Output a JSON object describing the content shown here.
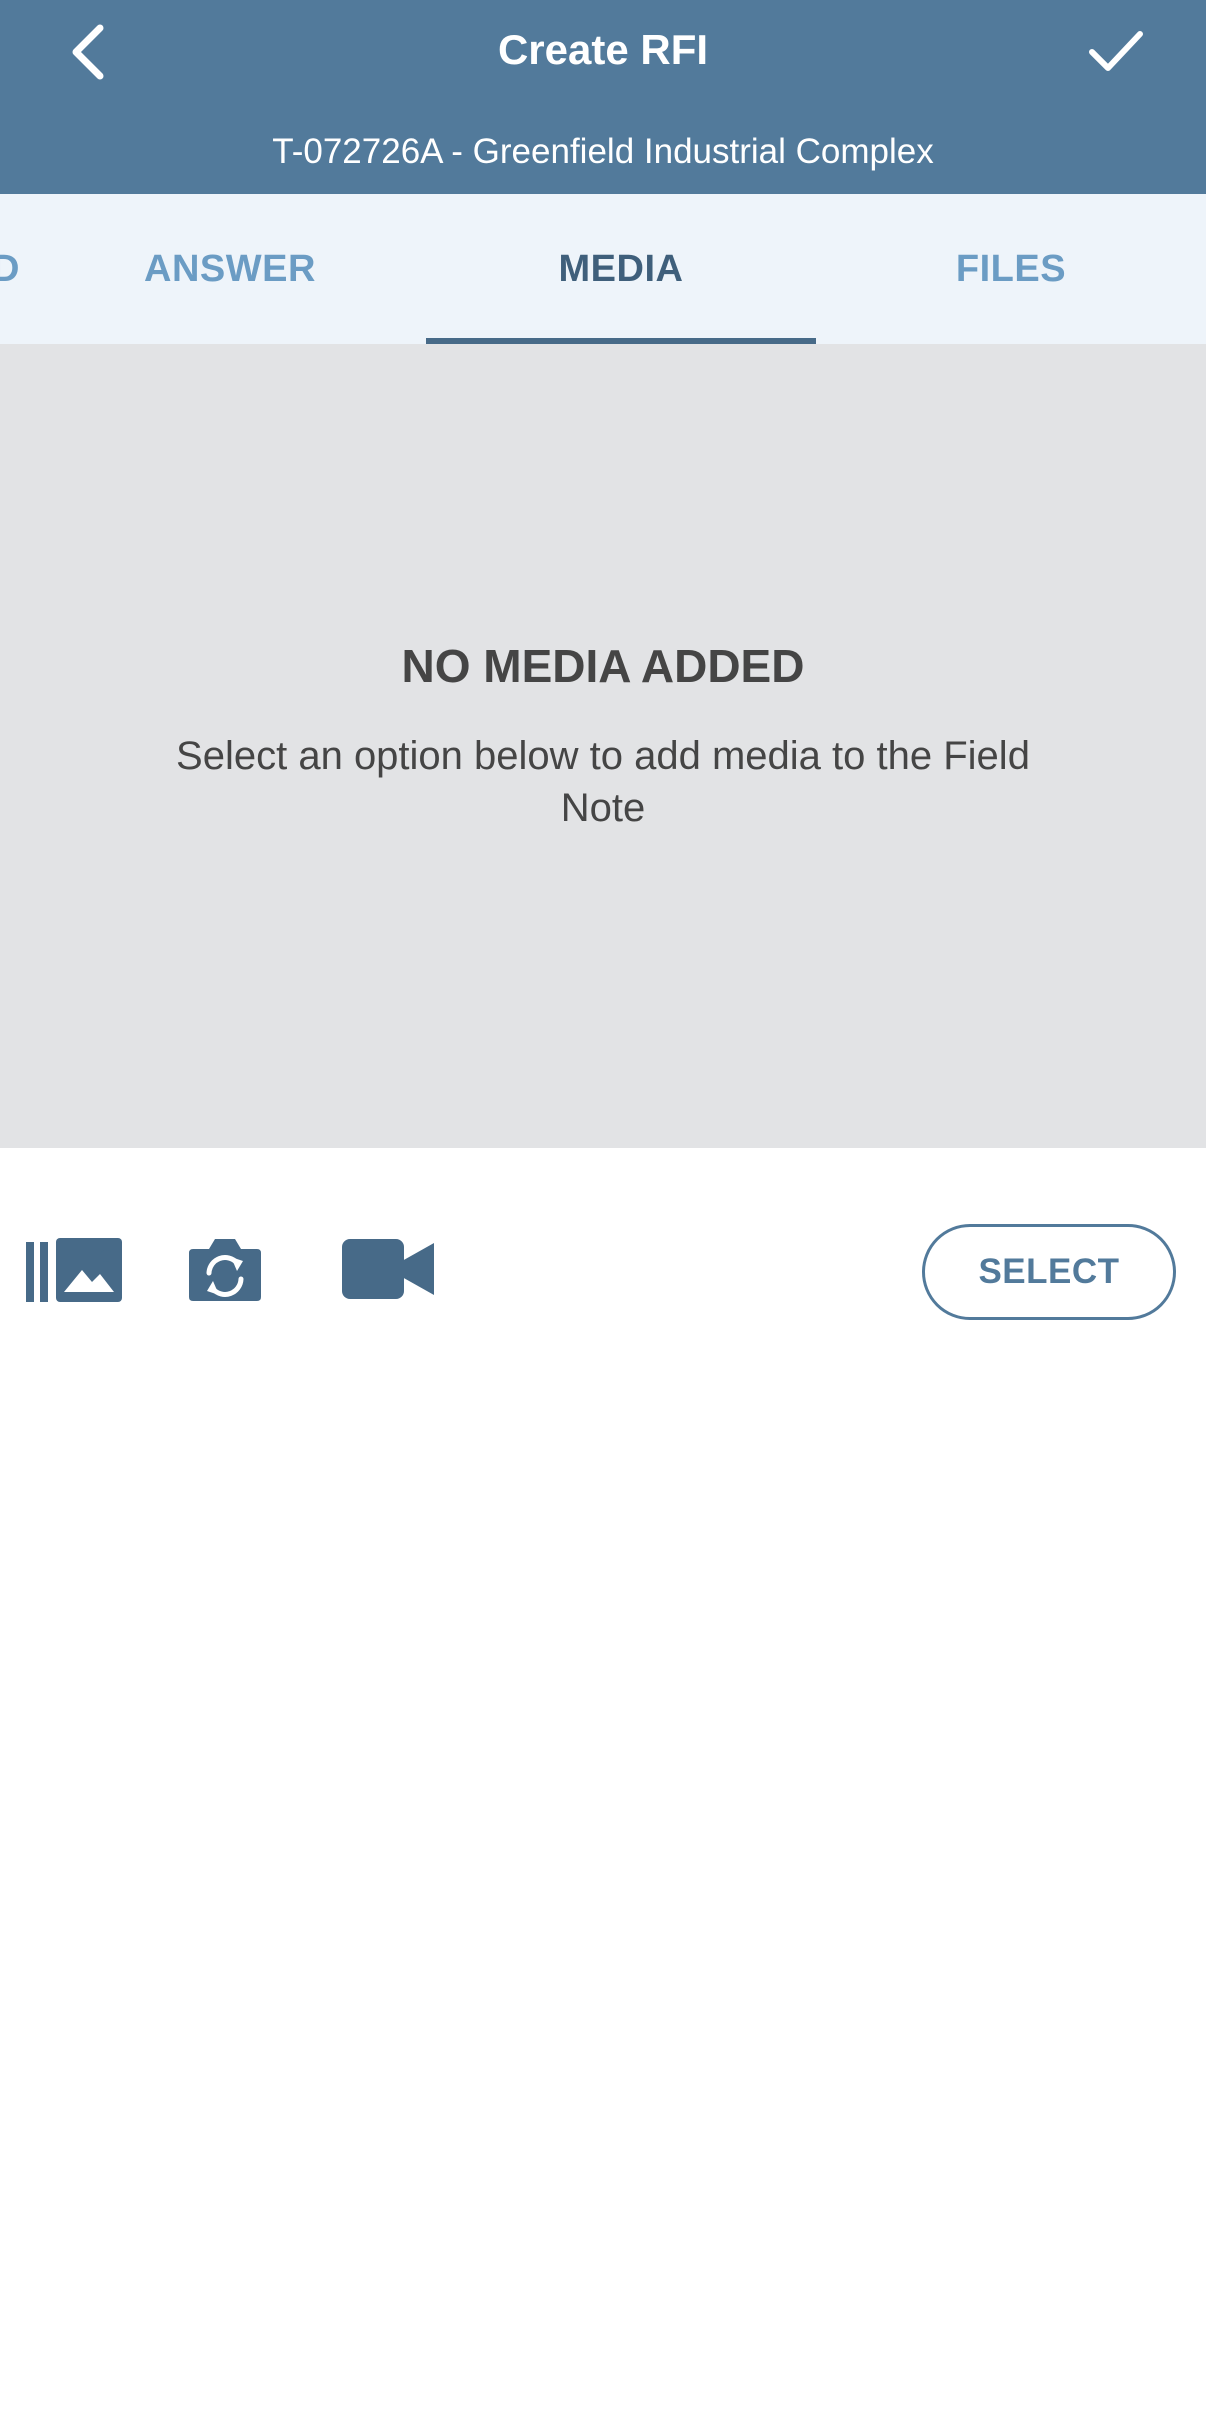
{
  "header": {
    "title": "Create RFI",
    "subtitle": "T-072726A - Greenfield Industrial Complex",
    "back_icon": "chevron-left-icon",
    "confirm_icon": "checkmark-icon",
    "background_color": "#527a9b"
  },
  "tabs": [
    {
      "label": "D",
      "active": false
    },
    {
      "label": "ANSWER",
      "active": false
    },
    {
      "label": "MEDIA",
      "active": true
    },
    {
      "label": "FILES",
      "active": false
    }
  ],
  "empty_state": {
    "title": "NO MEDIA ADDED",
    "message": "Select an option below to add media to the Field Note"
  },
  "toolbar": {
    "icons": [
      "photo-library-icon",
      "camera-switch-icon",
      "video-camera-icon"
    ],
    "select_label": "SELECT"
  },
  "colors": {
    "accent": "#527a9b",
    "tab_inactive": "#6b9cc4",
    "tab_active": "#3f5f7b",
    "empty_bg": "#e2e3e5"
  }
}
